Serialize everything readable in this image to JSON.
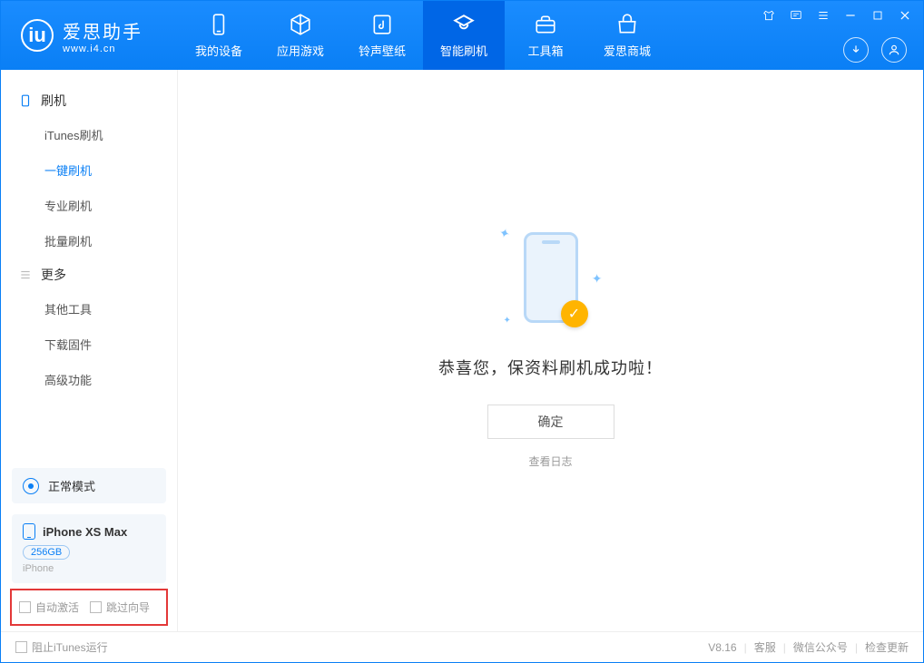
{
  "app": {
    "name_cn": "爱思助手",
    "url": "www.i4.cn",
    "version": "V8.16"
  },
  "tabs": [
    {
      "label": "我的设备",
      "icon": "device"
    },
    {
      "label": "应用游戏",
      "icon": "cube"
    },
    {
      "label": "铃声壁纸",
      "icon": "music"
    },
    {
      "label": "智能刷机",
      "icon": "refresh",
      "active": true
    },
    {
      "label": "工具箱",
      "icon": "toolbox"
    },
    {
      "label": "爱思商城",
      "icon": "shop"
    }
  ],
  "sidebar": {
    "group1": {
      "title": "刷机",
      "items": [
        "iTunes刷机",
        "一键刷机",
        "专业刷机",
        "批量刷机"
      ],
      "selected_index": 1
    },
    "group2": {
      "title": "更多",
      "items": [
        "其他工具",
        "下载固件",
        "高级功能"
      ]
    },
    "mode": "正常模式",
    "device": {
      "name": "iPhone XS Max",
      "capacity": "256GB",
      "type": "iPhone"
    },
    "options": {
      "auto_activate": "自动激活",
      "skip_guide": "跳过向导"
    }
  },
  "main": {
    "success_msg": "恭喜您，保资料刷机成功啦！",
    "ok_btn": "确定",
    "view_log": "查看日志"
  },
  "footer": {
    "block_itunes": "阻止iTunes运行",
    "links": [
      "客服",
      "微信公众号",
      "检查更新"
    ]
  }
}
